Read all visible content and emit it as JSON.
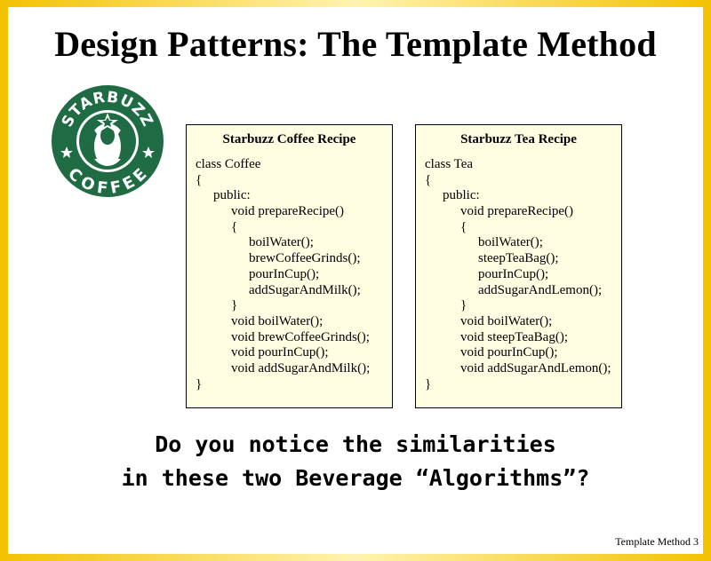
{
  "slide": {
    "title": "Design Patterns: The Template Method",
    "logo": {
      "icon": "starbuzz-coffee-logo",
      "top_text": "STARBUZZ",
      "bottom_text": "COFFEE",
      "color": "#1f6b43"
    },
    "question_line1": "Do you notice the similarities",
    "question_line2": "in these two Beverage “Algorithms”?",
    "footer": "Template Method 3"
  },
  "coffee": {
    "title": "Starbuzz Coffee Recipe",
    "lines": [
      "class Coffee",
      "{",
      "public:",
      "void prepareRecipe()",
      "{",
      "boilWater();",
      "brewCoffeeGrinds();",
      "pourInCup();",
      "addSugarAndMilk();",
      "}",
      "void boilWater();",
      "void brewCoffeeGrinds();",
      "void pourInCup();",
      "void addSugarAndMilk();",
      "}"
    ]
  },
  "tea": {
    "title": "Starbuzz Tea Recipe",
    "lines": [
      "class Tea",
      "{",
      "public:",
      "void prepareRecipe()",
      "{",
      "boilWater();",
      "steepTeaBag();",
      "pourInCup();",
      "addSugarAndLemon();",
      "}",
      "void boilWater();",
      "void steepTeaBag();",
      "void pourInCup();",
      "void addSugarAndLemon();",
      "}"
    ]
  }
}
